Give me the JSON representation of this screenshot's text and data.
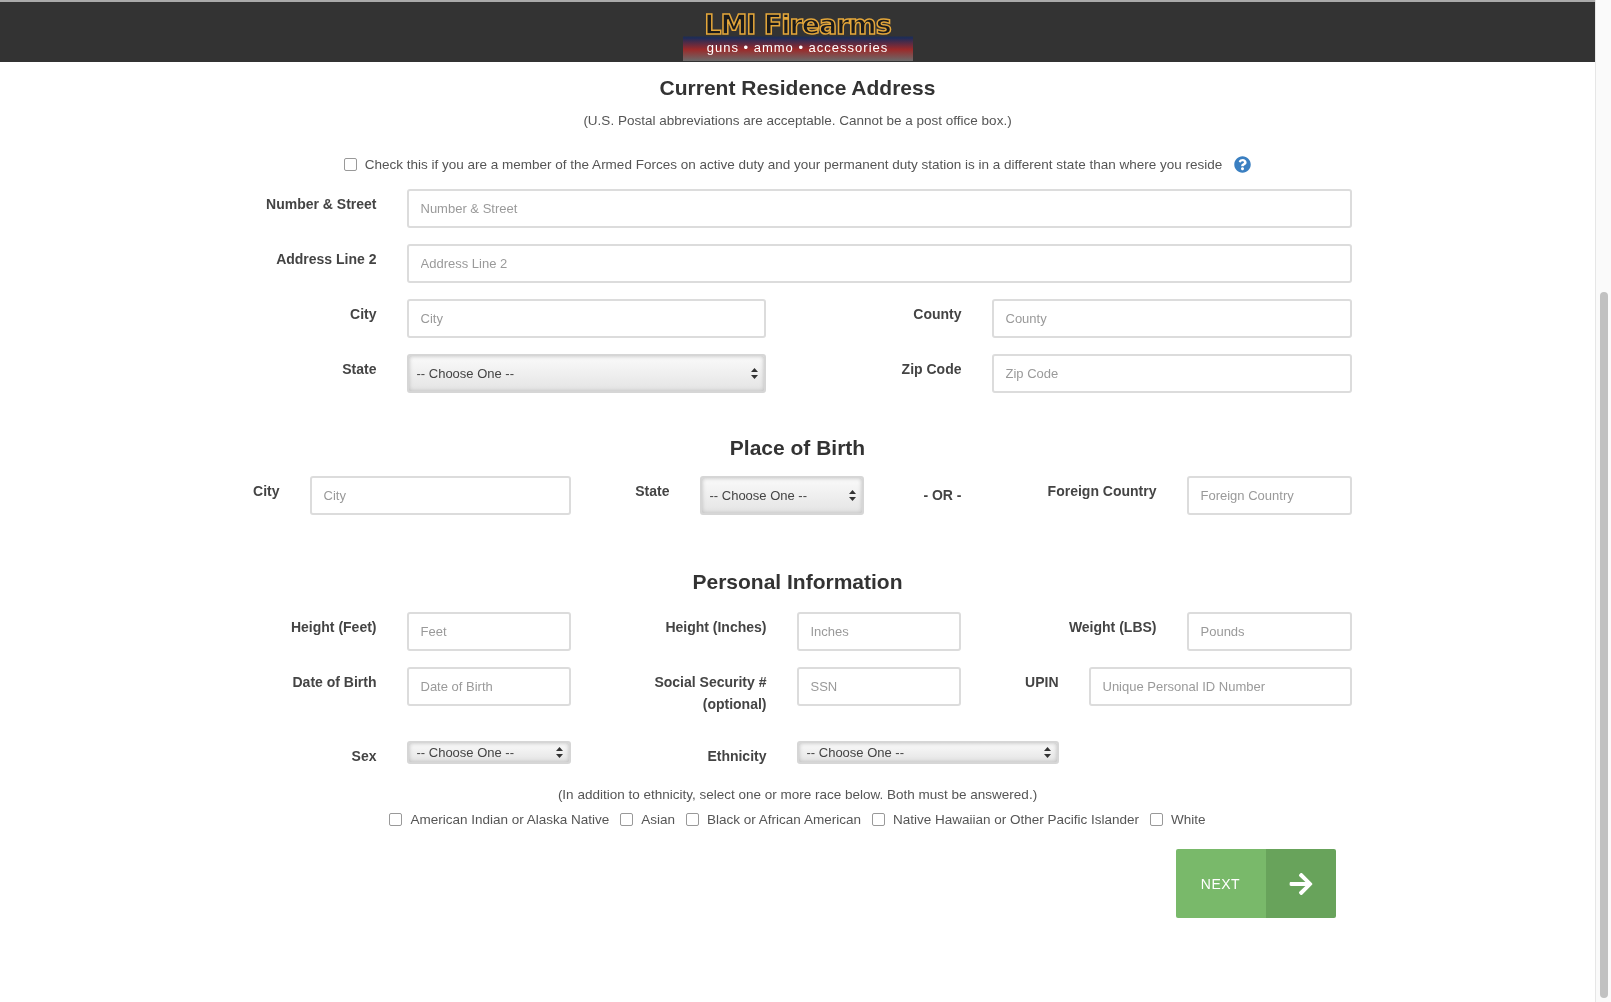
{
  "header": {
    "logo_title": "LMI Firearms",
    "logo_tagline": "guns • ammo • accessories"
  },
  "residence": {
    "title": "Current Residence Address",
    "note": "(U.S. Postal abbreviations are acceptable. Cannot be a post office box.)",
    "armed_forces": {
      "label": "Check this if you are a member of the Armed Forces on active duty and your permanent duty station is in a different state than where you reside",
      "checked": false
    },
    "rows": [
      [
        {
          "label": "Number & Street",
          "kind": "input",
          "placeholder": "Number & Street"
        }
      ],
      [
        {
          "label": "Address Line 2",
          "kind": "input",
          "placeholder": "Address Line 2"
        }
      ],
      [
        {
          "label": "City",
          "kind": "input",
          "placeholder": "City"
        },
        {
          "label": "County",
          "kind": "input",
          "placeholder": "County"
        }
      ],
      [
        {
          "label": "State",
          "kind": "select",
          "value": "-- Choose One --"
        },
        {
          "label": "Zip Code",
          "kind": "input",
          "placeholder": "Zip Code"
        }
      ]
    ]
  },
  "birth": {
    "title": "Place of Birth",
    "rows": [
      [
        {
          "label": "City",
          "kind": "input",
          "placeholder": "City"
        },
        {
          "label": "State",
          "kind": "select",
          "value": "-- Choose One --"
        },
        {
          "kind": "separator",
          "text": "- OR -"
        },
        {
          "label": "Foreign Country",
          "kind": "input",
          "placeholder": "Foreign Country"
        }
      ]
    ]
  },
  "personal": {
    "title": "Personal Information",
    "rows": [
      [
        {
          "label": "Height (Feet)",
          "kind": "input",
          "placeholder": "Feet"
        },
        {
          "label": "Height (Inches)",
          "kind": "input",
          "placeholder": "Inches"
        },
        {
          "label": "Weight (LBS)",
          "kind": "input",
          "placeholder": "Pounds"
        }
      ],
      [
        {
          "label": "Date of Birth",
          "kind": "input",
          "placeholder": "Date of Birth"
        },
        {
          "label": "Social Security # (optional)",
          "kind": "input",
          "placeholder": "SSN"
        },
        {
          "label": "UPIN",
          "kind": "input",
          "placeholder": "Unique Personal ID Number"
        }
      ],
      [
        {
          "label": "Sex",
          "kind": "select",
          "value": "-- Choose One --"
        },
        {
          "label": "Ethnicity",
          "kind": "select",
          "value": "-- Choose One --"
        }
      ]
    ],
    "race_note": "(In addition to ethnicity, select one or more race below. Both must be answered.)",
    "races": [
      {
        "label": "American Indian or Alaska Native",
        "checked": false
      },
      {
        "label": "Asian",
        "checked": false
      },
      {
        "label": "Black or African American",
        "checked": false
      },
      {
        "label": "Native Hawaiian or Other Pacific Islander",
        "checked": false
      },
      {
        "label": "White",
        "checked": false
      }
    ]
  },
  "next_button": "NEXT"
}
